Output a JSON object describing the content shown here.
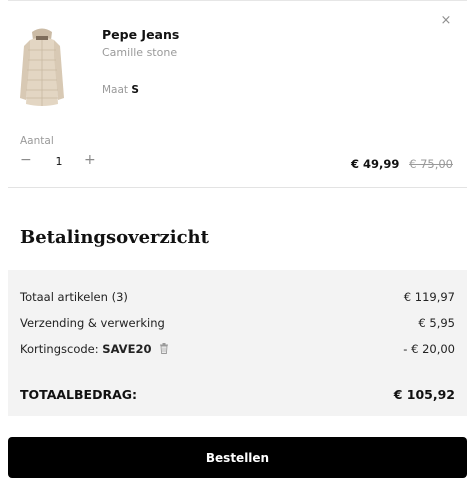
{
  "cart_item": {
    "brand": "Pepe Jeans",
    "variant": "Camille stone",
    "size_label": "Maat",
    "size_value": "S",
    "quantity_label": "Aantal",
    "quantity": "1",
    "price_current": "€ 49,99",
    "price_old": "€ 75,00",
    "image_icon": "jacket-image"
  },
  "summary": {
    "title": "Betalingsoverzicht",
    "rows": [
      {
        "label": "Totaal artikelen (3)",
        "value": "€ 119,97"
      },
      {
        "label": "Verzending & verwerking",
        "value": "€ 5,95"
      }
    ],
    "discount": {
      "label": "Kortingscode:",
      "code": "SAVE20",
      "value": "- € 20,00",
      "icon": "trash-icon"
    },
    "total": {
      "label": "TOTAALBEDRAG:",
      "value": "€ 105,92"
    }
  },
  "checkout": {
    "button_label": "Bestellen"
  },
  "colors": {
    "button_bg": "#000000",
    "summary_bg": "#f3f3f3",
    "muted_text": "#9a9a9a"
  }
}
